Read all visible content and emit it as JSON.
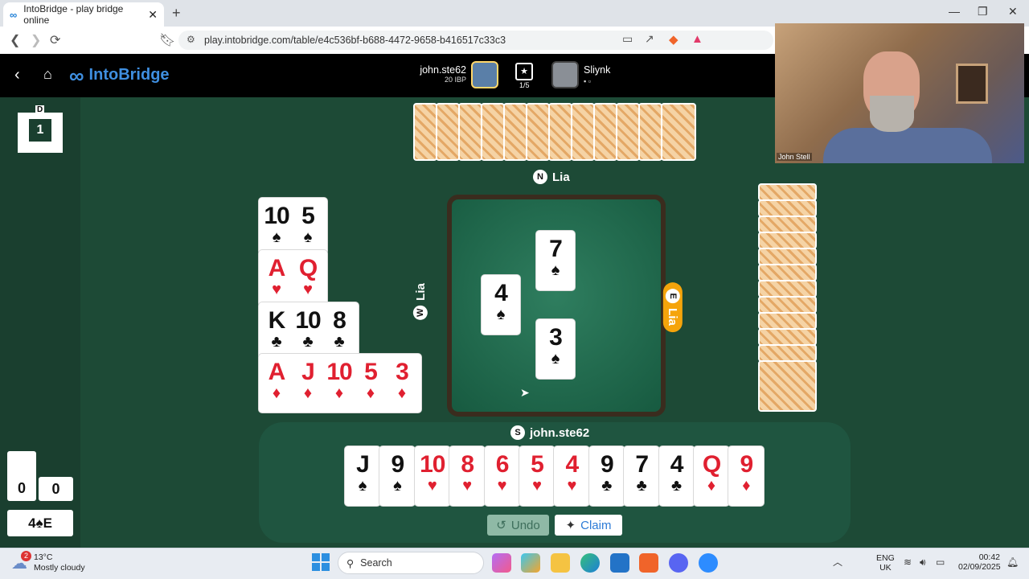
{
  "browser": {
    "tab_title": "IntoBridge - play bridge online",
    "new_tab": "+",
    "url": "play.intobridge.com/table/e4c536bf-b688-4472-9658-b416517c33c3",
    "min": "—",
    "max": "❐",
    "close": "✕"
  },
  "app": {
    "brand": "IntoBridge",
    "player1": {
      "name": "john.ste62",
      "sub": "20 IBP"
    },
    "progress": "1/5",
    "player2": {
      "name": "Sliynk"
    }
  },
  "video": {
    "label": "John Stell"
  },
  "board": {
    "dealer": "D",
    "number": "1"
  },
  "score": {
    "ns": "0",
    "ew": "0"
  },
  "contract": "4♠E",
  "seats": {
    "north": {
      "letter": "N",
      "name": "Lia"
    },
    "west": {
      "letter": "W",
      "name": "Lia"
    },
    "east": {
      "letter": "E",
      "name": "Lia"
    },
    "south": {
      "letter": "S",
      "name": "john.ste62"
    }
  },
  "dummy_rows": [
    [
      {
        "r": "10",
        "s": "♠"
      },
      {
        "r": "5",
        "s": "♠"
      }
    ],
    [
      {
        "r": "A",
        "s": "♥"
      },
      {
        "r": "Q",
        "s": "♥"
      }
    ],
    [
      {
        "r": "K",
        "s": "♣"
      },
      {
        "r": "10",
        "s": "♣"
      },
      {
        "r": "8",
        "s": "♣"
      }
    ],
    [
      {
        "r": "A",
        "s": "♦"
      },
      {
        "r": "J",
        "s": "♦"
      },
      {
        "r": "10",
        "s": "♦"
      },
      {
        "r": "5",
        "s": "♦"
      },
      {
        "r": "3",
        "s": "♦"
      }
    ]
  ],
  "trick": {
    "north": {
      "r": "7",
      "s": "♠"
    },
    "west": {
      "r": "4",
      "s": "♠"
    },
    "south": {
      "r": "3",
      "s": "♠"
    }
  },
  "south_hand": [
    {
      "r": "J",
      "s": "♠"
    },
    {
      "r": "9",
      "s": "♠"
    },
    {
      "r": "10",
      "s": "♥"
    },
    {
      "r": "8",
      "s": "♥"
    },
    {
      "r": "6",
      "s": "♥"
    },
    {
      "r": "5",
      "s": "♥"
    },
    {
      "r": "4",
      "s": "♥"
    },
    {
      "r": "9",
      "s": "♣"
    },
    {
      "r": "7",
      "s": "♣"
    },
    {
      "r": "4",
      "s": "♣"
    },
    {
      "r": "Q",
      "s": "♦"
    },
    {
      "r": "9",
      "s": "♦"
    }
  ],
  "north_cards": 12,
  "east_cards": 12,
  "buttons": {
    "undo": "Undo",
    "claim": "Claim"
  },
  "taskbar": {
    "weather_temp": "13°C",
    "weather_desc": "Mostly cloudy",
    "weather_badge": "2",
    "search": "Search",
    "lang1": "ENG",
    "lang2": "UK",
    "time": "00:42",
    "date": "02/09/2025"
  }
}
